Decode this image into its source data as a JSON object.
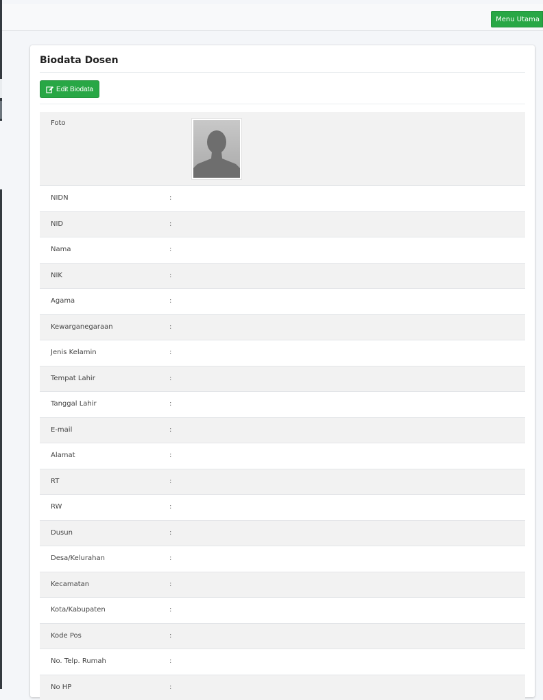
{
  "navbar": {
    "menu_label": "Menu Utama"
  },
  "card": {
    "title": "Biodata Dosen",
    "edit_label": "Edit Biodata"
  },
  "biodata": {
    "photo_label": "Foto",
    "separator": ":",
    "fields": [
      "NIDN",
      "NID",
      "Nama",
      "NIK",
      "Agama",
      "Kewarganegaraan",
      "Jenis Kelamin",
      "Tempat Lahir",
      "Tanggal Lahir",
      "E-mail",
      "Alamat",
      "RT",
      "RW",
      "Dusun",
      "Desa/Kelurahan",
      "Kecamatan",
      "Kota/Kabupaten",
      "Kode Pos",
      "No. Telp. Rumah",
      "No HP"
    ]
  },
  "colors": {
    "accent": "#28a745",
    "row_stripe": "#f2f2f2"
  }
}
